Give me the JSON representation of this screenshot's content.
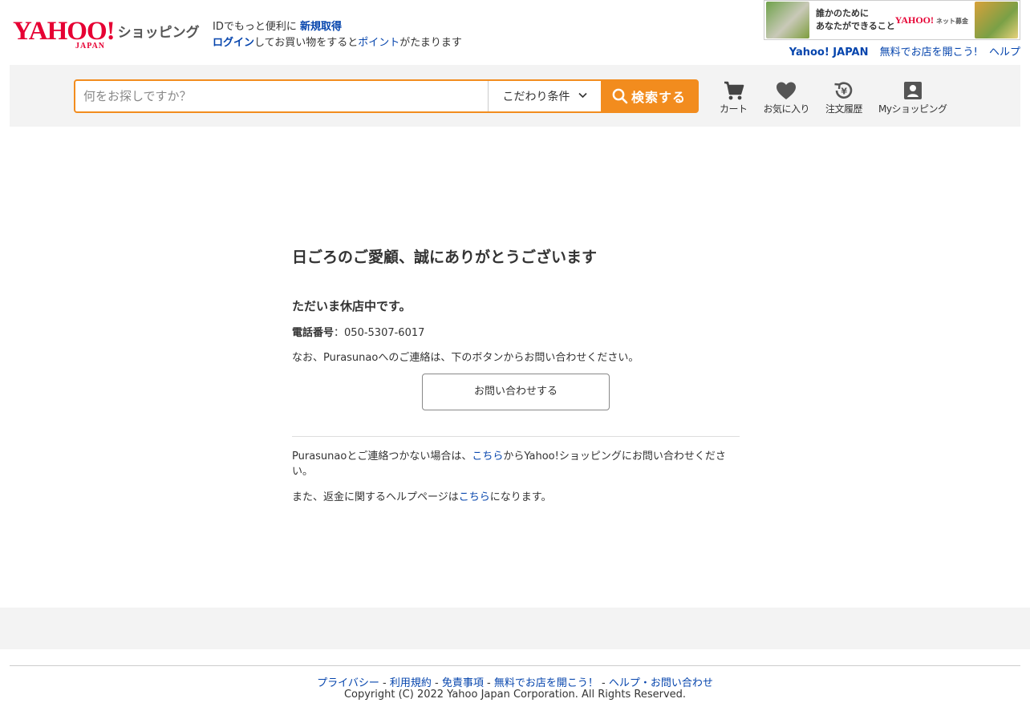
{
  "header": {
    "logo_main": "YAHOO!",
    "logo_sub": "JAPAN",
    "logo_service": "ショッピング",
    "id_line1_text": "IDでもっと便利に",
    "id_line1_link": "新規取得",
    "id_line2_link_login": "ログイン",
    "id_line2_text_mid": "してお買い物をすると",
    "id_line2_link_point": "ポイント",
    "id_line2_text_end": "がたまります",
    "banner_line1": "誰かのために",
    "banner_line2": "あなたができること",
    "banner_logo": "YAHOO!",
    "banner_logo_small": "ネット募金",
    "toplinks": [
      "Yahoo! JAPAN",
      "無料でお店を開こう!",
      "ヘルプ"
    ]
  },
  "search": {
    "placeholder": "何をお探しですか？",
    "condition_label": "こだわり条件",
    "button_label": "検索する",
    "accent_color": "#f28c1e"
  },
  "nav": [
    {
      "label": "カート",
      "icon": "cart-icon"
    },
    {
      "label": "お気に入り",
      "icon": "heart-icon"
    },
    {
      "label": "注文履歴",
      "icon": "order-history-icon"
    },
    {
      "label": "Myショッピング",
      "icon": "account-icon"
    }
  ],
  "main": {
    "title": "日ごろのご愛顧、誠にありがとうございます",
    "closed": "ただいま休店中です。",
    "tel_label": "電話番号",
    "tel_sep": "：",
    "tel_value": "050-5307-6017",
    "note": "なお、Purasunaoへのご連絡は、下のボタンからお問い合わせください。",
    "contact_button": "お問い合わせする",
    "p1_before": "Purasunaoとご連絡つかない場合は、",
    "p1_link": "こちら",
    "p1_after": "からYahoo!ショッピングにお問い合わせください。",
    "p2_before": "また、返金に関するヘルプページは",
    "p2_link": "こちら",
    "p2_after": "になります。"
  },
  "footer": {
    "links": [
      "プライバシー",
      "利用規約",
      "免責事項",
      "無料でお店を開こう！",
      "ヘルプ・お問い合わせ"
    ],
    "separator": " - ",
    "copyright": "Copyright (C) 2022 Yahoo Japan Corporation. All Rights Reserved."
  }
}
